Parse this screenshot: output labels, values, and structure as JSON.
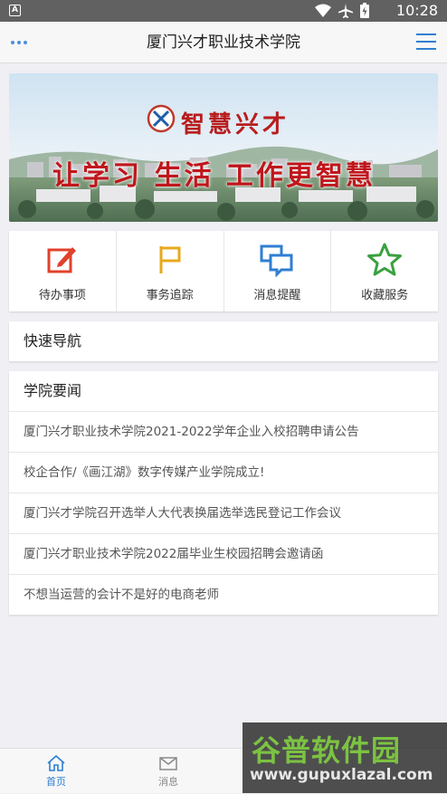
{
  "statusbar": {
    "left_badge": "A",
    "time": "10:28"
  },
  "navbar": {
    "title": "厦门兴才职业技术学院"
  },
  "banner": {
    "logo_text": "智慧兴才",
    "slogan": "让学习 生活 工作更智慧"
  },
  "quick_actions": [
    {
      "label": "待办事项",
      "icon": "edit-icon",
      "color": "#e0412c"
    },
    {
      "label": "事务追踪",
      "icon": "flag-icon",
      "color": "#e7a91d"
    },
    {
      "label": "消息提醒",
      "icon": "chat-icon",
      "color": "#2f7fd2"
    },
    {
      "label": "收藏服务",
      "icon": "star-icon",
      "color": "#3aa040"
    }
  ],
  "quick_nav": {
    "title": "快速导航"
  },
  "news": {
    "title": "学院要闻",
    "items": [
      "厦门兴才职业技术学院2021-2022学年企业入校招聘申请公告",
      "校企合作/《画江湖》数字传媒产业学院成立!",
      "厦门兴才学院召开选举人大代表换届选举选民登记工作会议",
      "厦门兴才职业技术学院2022届毕业生校园招聘会邀请函",
      "不想当运营的会计不是好的电商老师"
    ]
  },
  "tabbar": {
    "tabs": [
      {
        "label": "首页",
        "active": true
      },
      {
        "label": "消息",
        "active": false
      }
    ]
  },
  "watermark": {
    "brand": "谷普软件园",
    "url": "www.gupuxlazal.com"
  },
  "colors": {
    "accent": "#2f7fd2",
    "statusbar": "#616161"
  }
}
